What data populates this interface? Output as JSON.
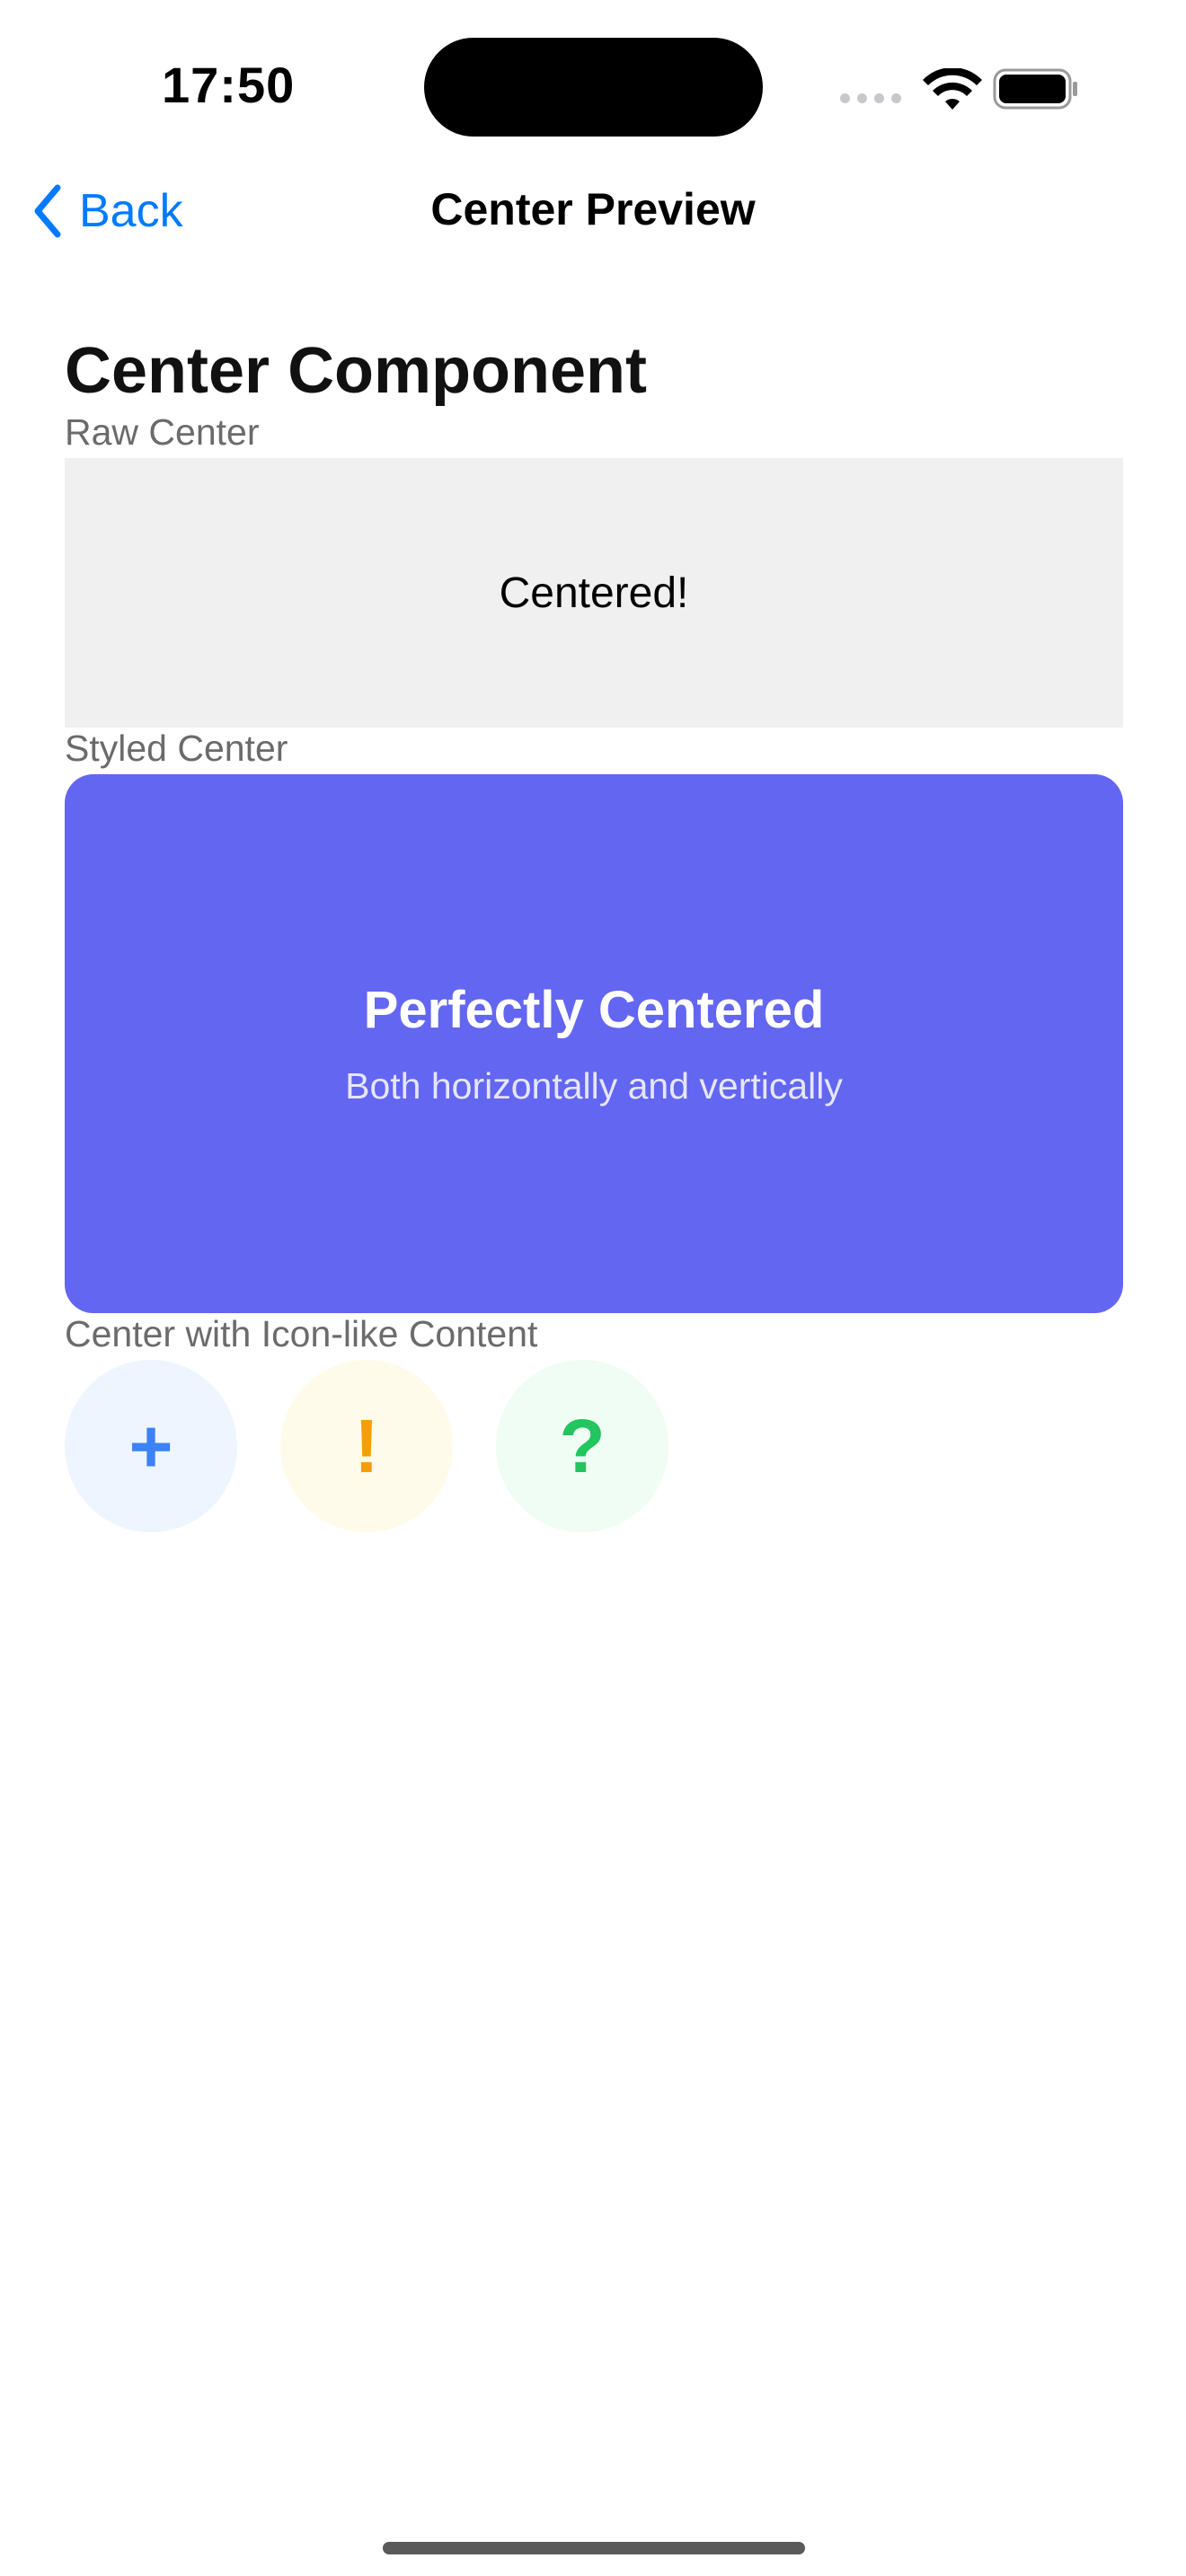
{
  "status_bar": {
    "time": "17:50"
  },
  "nav": {
    "back_label": "Back",
    "title": "Center Preview"
  },
  "content": {
    "page_title": "Center Component",
    "raw_section": {
      "label": "Raw Center",
      "text": "Centered!"
    },
    "styled_section": {
      "label": "Styled Center",
      "title": "Perfectly Centered",
      "subtitle": "Both horizontally and vertically",
      "background_color": "#6366f1"
    },
    "icon_section": {
      "label": "Center with Icon-like Content",
      "icons": [
        {
          "glyph": "+",
          "name": "plus-icon",
          "color": "#3b82f6",
          "background": "#eef5ff"
        },
        {
          "glyph": "!",
          "name": "exclamation-icon",
          "color": "#f59e0b",
          "background": "#fffbea"
        },
        {
          "glyph": "?",
          "name": "question-icon",
          "color": "#22c55e",
          "background": "#effdf4"
        }
      ]
    }
  },
  "colors": {
    "accent": "#007aff"
  }
}
